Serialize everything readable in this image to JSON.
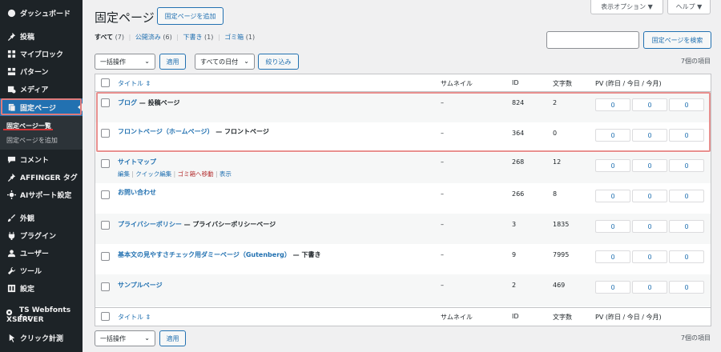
{
  "sidebar": {
    "items": [
      {
        "label": "ダッシュボード",
        "icon": "dashboard-icon"
      },
      {
        "label": "投稿",
        "icon": "pin-icon"
      },
      {
        "label": "マイブロック",
        "icon": "blocks-icon"
      },
      {
        "label": "パターン",
        "icon": "pattern-icon"
      },
      {
        "label": "メディア",
        "icon": "media-icon"
      },
      {
        "label": "固定ページ",
        "icon": "page-icon"
      },
      {
        "label": "コメント",
        "icon": "comment-icon"
      },
      {
        "label": "AFFINGER タグ",
        "icon": "pin-icon"
      },
      {
        "label": "AIサポート設定",
        "icon": "ai-icon"
      },
      {
        "label": "外観",
        "icon": "brush-icon"
      },
      {
        "label": "プラグイン",
        "icon": "plugin-icon"
      },
      {
        "label": "ユーザー",
        "icon": "user-icon"
      },
      {
        "label": "ツール",
        "icon": "wrench-icon"
      },
      {
        "label": "設定",
        "icon": "settings-icon"
      },
      {
        "label": "クリック計測",
        "icon": "click-icon"
      }
    ],
    "ts_line1": "TS Webfonts for",
    "ts_line2": "XSERVER",
    "submenu": {
      "current": "固定ページ一覧",
      "add": "固定ページを追加"
    }
  },
  "header": {
    "title": "固定ページ",
    "add_button": "固定ページを追加",
    "screen_options": "表示オプション ▼",
    "help": "ヘルプ ▼"
  },
  "filters": {
    "all": "すべて",
    "all_count": "(7)",
    "published": "公開済み",
    "published_count": "(6)",
    "draft": "下書き",
    "draft_count": "(1)",
    "trash": "ゴミ箱",
    "trash_count": "(1)",
    "sep": "|"
  },
  "search": {
    "button": "固定ページを検索",
    "value": ""
  },
  "bulk": {
    "select": "一括操作",
    "apply": "適用",
    "dates": "すべての日付",
    "filter": "絞り込み",
    "items_count": "7個の項目"
  },
  "table": {
    "columns": {
      "title": "タイトル",
      "thumb": "サムネイル",
      "id": "ID",
      "chars": "文字数",
      "pv": "PV (昨日 / 今日 / 今月)"
    },
    "rows": [
      {
        "title": "ブログ",
        "state": " — 投稿ページ",
        "thumb": "–",
        "id": "824",
        "chars": "2",
        "pv": [
          "0",
          "0",
          "0"
        ]
      },
      {
        "title": "フロントページ（ホームページ）",
        "state": " — フロントページ",
        "thumb": "–",
        "id": "364",
        "chars": "0",
        "pv": [
          "0",
          "0",
          "0"
        ]
      },
      {
        "title": "サイトマップ",
        "state": "",
        "thumb": "–",
        "id": "268",
        "chars": "12",
        "pv": [
          "0",
          "0",
          "0"
        ]
      },
      {
        "title": "お問い合わせ",
        "state": "",
        "thumb": "–",
        "id": "266",
        "chars": "8",
        "pv": [
          "0",
          "0",
          "0"
        ]
      },
      {
        "title": "プライバシーポリシー",
        "state": " — プライバシーポリシーページ",
        "thumb": "–",
        "id": "3",
        "chars": "1835",
        "pv": [
          "0",
          "0",
          "0"
        ]
      },
      {
        "title": "基本文の見やすさチェック用ダミーページ（Gutenberg）",
        "state": " — 下書き",
        "thumb": "–",
        "id": "9",
        "chars": "7995",
        "pv": [
          "0",
          "0",
          "0"
        ]
      },
      {
        "title": "サンプルページ",
        "state": "",
        "thumb": "–",
        "id": "2",
        "chars": "469",
        "pv": [
          "0",
          "0",
          "0"
        ]
      }
    ],
    "row_actions": {
      "edit": "編集",
      "quick_edit": "クイック編集",
      "trash": "ゴミ箱へ移動",
      "view": "表示",
      "sep": " | "
    }
  }
}
